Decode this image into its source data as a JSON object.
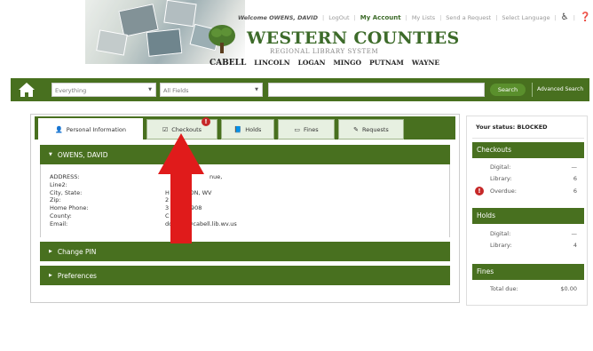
{
  "header": {
    "welcome_text": "Welcome OWENS, DAVID",
    "links": [
      "LogOut",
      "My Account",
      "My Lists",
      "Send a Request",
      "Select Language"
    ],
    "logo_title": "WESTERN COUNTIES",
    "logo_subtitle": "REGIONAL LIBRARY SYSTEM",
    "counties": [
      "CABELL",
      "LINCOLN",
      "LOGAN",
      "MINGO",
      "PUTNAM",
      "WAYNE"
    ]
  },
  "search": {
    "scope_value": "Everything",
    "field_value": "All Fields",
    "query_value": "",
    "search_label": "Search",
    "advanced_label": "Advanced Search"
  },
  "tabs": [
    {
      "label": "Personal Information",
      "icon": "user-icon",
      "active": true
    },
    {
      "label": "Checkouts",
      "icon": "checkbox-icon",
      "active": false,
      "alert": "!"
    },
    {
      "label": "Holds",
      "icon": "book-icon",
      "active": false
    },
    {
      "label": "Fines",
      "icon": "money-icon",
      "active": false
    },
    {
      "label": "Requests",
      "icon": "edit-icon",
      "active": false
    }
  ],
  "profile": {
    "name_header": "OWENS, DAVID",
    "labels": [
      "ADDRESS:",
      "Line2:",
      "City, State:",
      "Zip:",
      "Home Phone:",
      "County:",
      "Email:"
    ],
    "values": [
      "nue,",
      "",
      "H         TON, WV",
      "2",
      "3            908",
      "C",
      "dowens@cabell.lib.wv.us"
    ]
  },
  "sections": {
    "change_pin": "Change PIN",
    "preferences": "Preferences"
  },
  "sidebar": {
    "status_text": "Your status: BLOCKED",
    "checkouts": {
      "title": "Checkouts",
      "digital_label": "Digital:",
      "digital_value": "—",
      "library_label": "Library:",
      "library_value": "6",
      "overdue_label": "Overdue:",
      "overdue_value": "6",
      "overdue_icon": "!"
    },
    "holds": {
      "title": "Holds",
      "digital_label": "Digital:",
      "digital_value": "—",
      "library_label": "Library:",
      "library_value": "4"
    },
    "fines": {
      "title": "Fines",
      "total_label": "Total due:",
      "total_value": "$0.00"
    }
  },
  "colors": {
    "brand_green": "#48701f",
    "alert_red": "#c62828",
    "arrow_red": "#e01b1b"
  }
}
